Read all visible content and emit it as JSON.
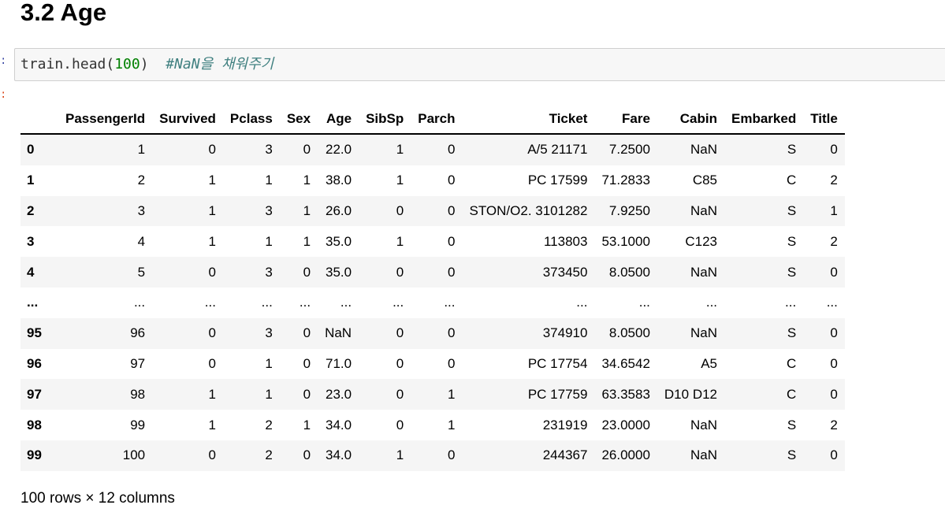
{
  "section": {
    "title": "3.2 Age"
  },
  "cell": {
    "prompt_in": ":",
    "prompt_out": ":",
    "code_prefix": "train.head(",
    "code_number": "100",
    "code_suffix": ")  ",
    "code_comment": "#NaN을 채워주기"
  },
  "table": {
    "columns": [
      "PassengerId",
      "Survived",
      "Pclass",
      "Sex",
      "Age",
      "SibSp",
      "Parch",
      "Ticket",
      "Fare",
      "Cabin",
      "Embarked",
      "Title"
    ],
    "rows": [
      {
        "index": "0",
        "cells": [
          "1",
          "0",
          "3",
          "0",
          "22.0",
          "1",
          "0",
          "A/5 21171",
          "7.2500",
          "NaN",
          "S",
          "0"
        ]
      },
      {
        "index": "1",
        "cells": [
          "2",
          "1",
          "1",
          "1",
          "38.0",
          "1",
          "0",
          "PC 17599",
          "71.2833",
          "C85",
          "C",
          "2"
        ]
      },
      {
        "index": "2",
        "cells": [
          "3",
          "1",
          "3",
          "1",
          "26.0",
          "0",
          "0",
          "STON/O2. 3101282",
          "7.9250",
          "NaN",
          "S",
          "1"
        ]
      },
      {
        "index": "3",
        "cells": [
          "4",
          "1",
          "1",
          "1",
          "35.0",
          "1",
          "0",
          "113803",
          "53.1000",
          "C123",
          "S",
          "2"
        ]
      },
      {
        "index": "4",
        "cells": [
          "5",
          "0",
          "3",
          "0",
          "35.0",
          "0",
          "0",
          "373450",
          "8.0500",
          "NaN",
          "S",
          "0"
        ]
      },
      {
        "index": "...",
        "cells": [
          "...",
          "...",
          "...",
          "...",
          "...",
          "...",
          "...",
          "...",
          "...",
          "...",
          "...",
          "..."
        ]
      },
      {
        "index": "95",
        "cells": [
          "96",
          "0",
          "3",
          "0",
          "NaN",
          "0",
          "0",
          "374910",
          "8.0500",
          "NaN",
          "S",
          "0"
        ]
      },
      {
        "index": "96",
        "cells": [
          "97",
          "0",
          "1",
          "0",
          "71.0",
          "0",
          "0",
          "PC 17754",
          "34.6542",
          "A5",
          "C",
          "0"
        ]
      },
      {
        "index": "97",
        "cells": [
          "98",
          "1",
          "1",
          "0",
          "23.0",
          "0",
          "1",
          "PC 17759",
          "63.3583",
          "D10 D12",
          "C",
          "0"
        ]
      },
      {
        "index": "98",
        "cells": [
          "99",
          "1",
          "2",
          "1",
          "34.0",
          "0",
          "1",
          "231919",
          "23.0000",
          "NaN",
          "S",
          "2"
        ]
      },
      {
        "index": "99",
        "cells": [
          "100",
          "0",
          "2",
          "0",
          "34.0",
          "1",
          "0",
          "244367",
          "26.0000",
          "NaN",
          "S",
          "0"
        ]
      }
    ]
  },
  "footer": {
    "text": "100 rows × 12 columns"
  },
  "colors": {
    "code_number": "#008000",
    "code_comment": "#408080",
    "prompt_in": "#303f9f",
    "prompt_out": "#d84315",
    "row_stripe": "#f5f5f5"
  }
}
